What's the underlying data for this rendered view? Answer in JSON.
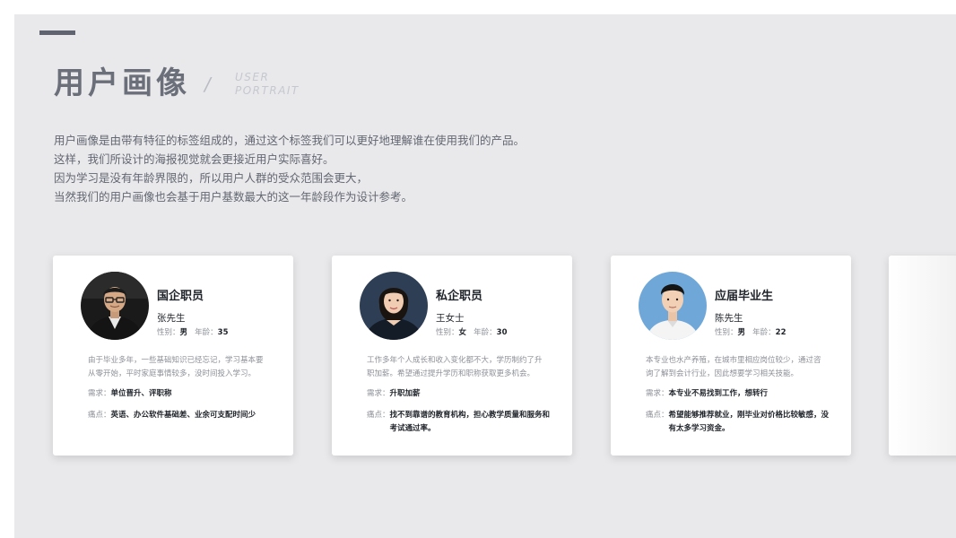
{
  "header": {
    "title": "用户画像",
    "slash": "/",
    "subtitle_line1": "USER",
    "subtitle_line2": "PORTRAIT"
  },
  "intro": [
    "用户画像是由带有特征的标签组成的，通过这个标签我们可以更好地理解谁在使用我们的产品。",
    "这样，我们所设计的海报视觉就会更接近用户实际喜好。",
    "因为学习是没有年龄界限的，所以用户人群的受众范围会更大，",
    "当然我们的用户画像也会基于用户基数最大的这一年龄段作为设计参考。"
  ],
  "labels": {
    "gender": "性别：",
    "age": "年龄：",
    "need": "需求：",
    "pain": "痛点："
  },
  "cards": [
    {
      "role": "国企职员",
      "name": "张先生",
      "gender": "男",
      "age": "35",
      "desc": "由于毕业多年，一些基础知识已经忘记，学习基本要从零开始，平时家庭事情较多，没时间投入学习。",
      "need": "单位晋升、评职称",
      "pain": "英语、办公软件基础差、业余可支配时间少"
    },
    {
      "role": "私企职员",
      "name": "王女士",
      "gender": "女",
      "age": "30",
      "desc": "工作多年个人成长和收入变化都不大，学历制约了升职加薪。希望通过提升学历和职称获取更多机会。",
      "need": "升职加薪",
      "pain": "找不到靠谱的教育机构，担心教学质量和服务和考试通过率。"
    },
    {
      "role": "应届毕业生",
      "name": "陈先生",
      "gender": "男",
      "age": "22",
      "desc": "本专业也水产养殖，在城市里相应岗位较少，通过咨询了解到会计行业，因此想要学习相关技能。",
      "need": "本专业不易找到工作，想转行",
      "pain": "希望能够推荐就业，刚毕业对价格比较敏感，没有太多学习资金。"
    }
  ],
  "colors": {
    "background": "#e9e9eb",
    "title": "#6b6f7a",
    "accent_bar": "#5f6470",
    "card": "#ffffff"
  }
}
